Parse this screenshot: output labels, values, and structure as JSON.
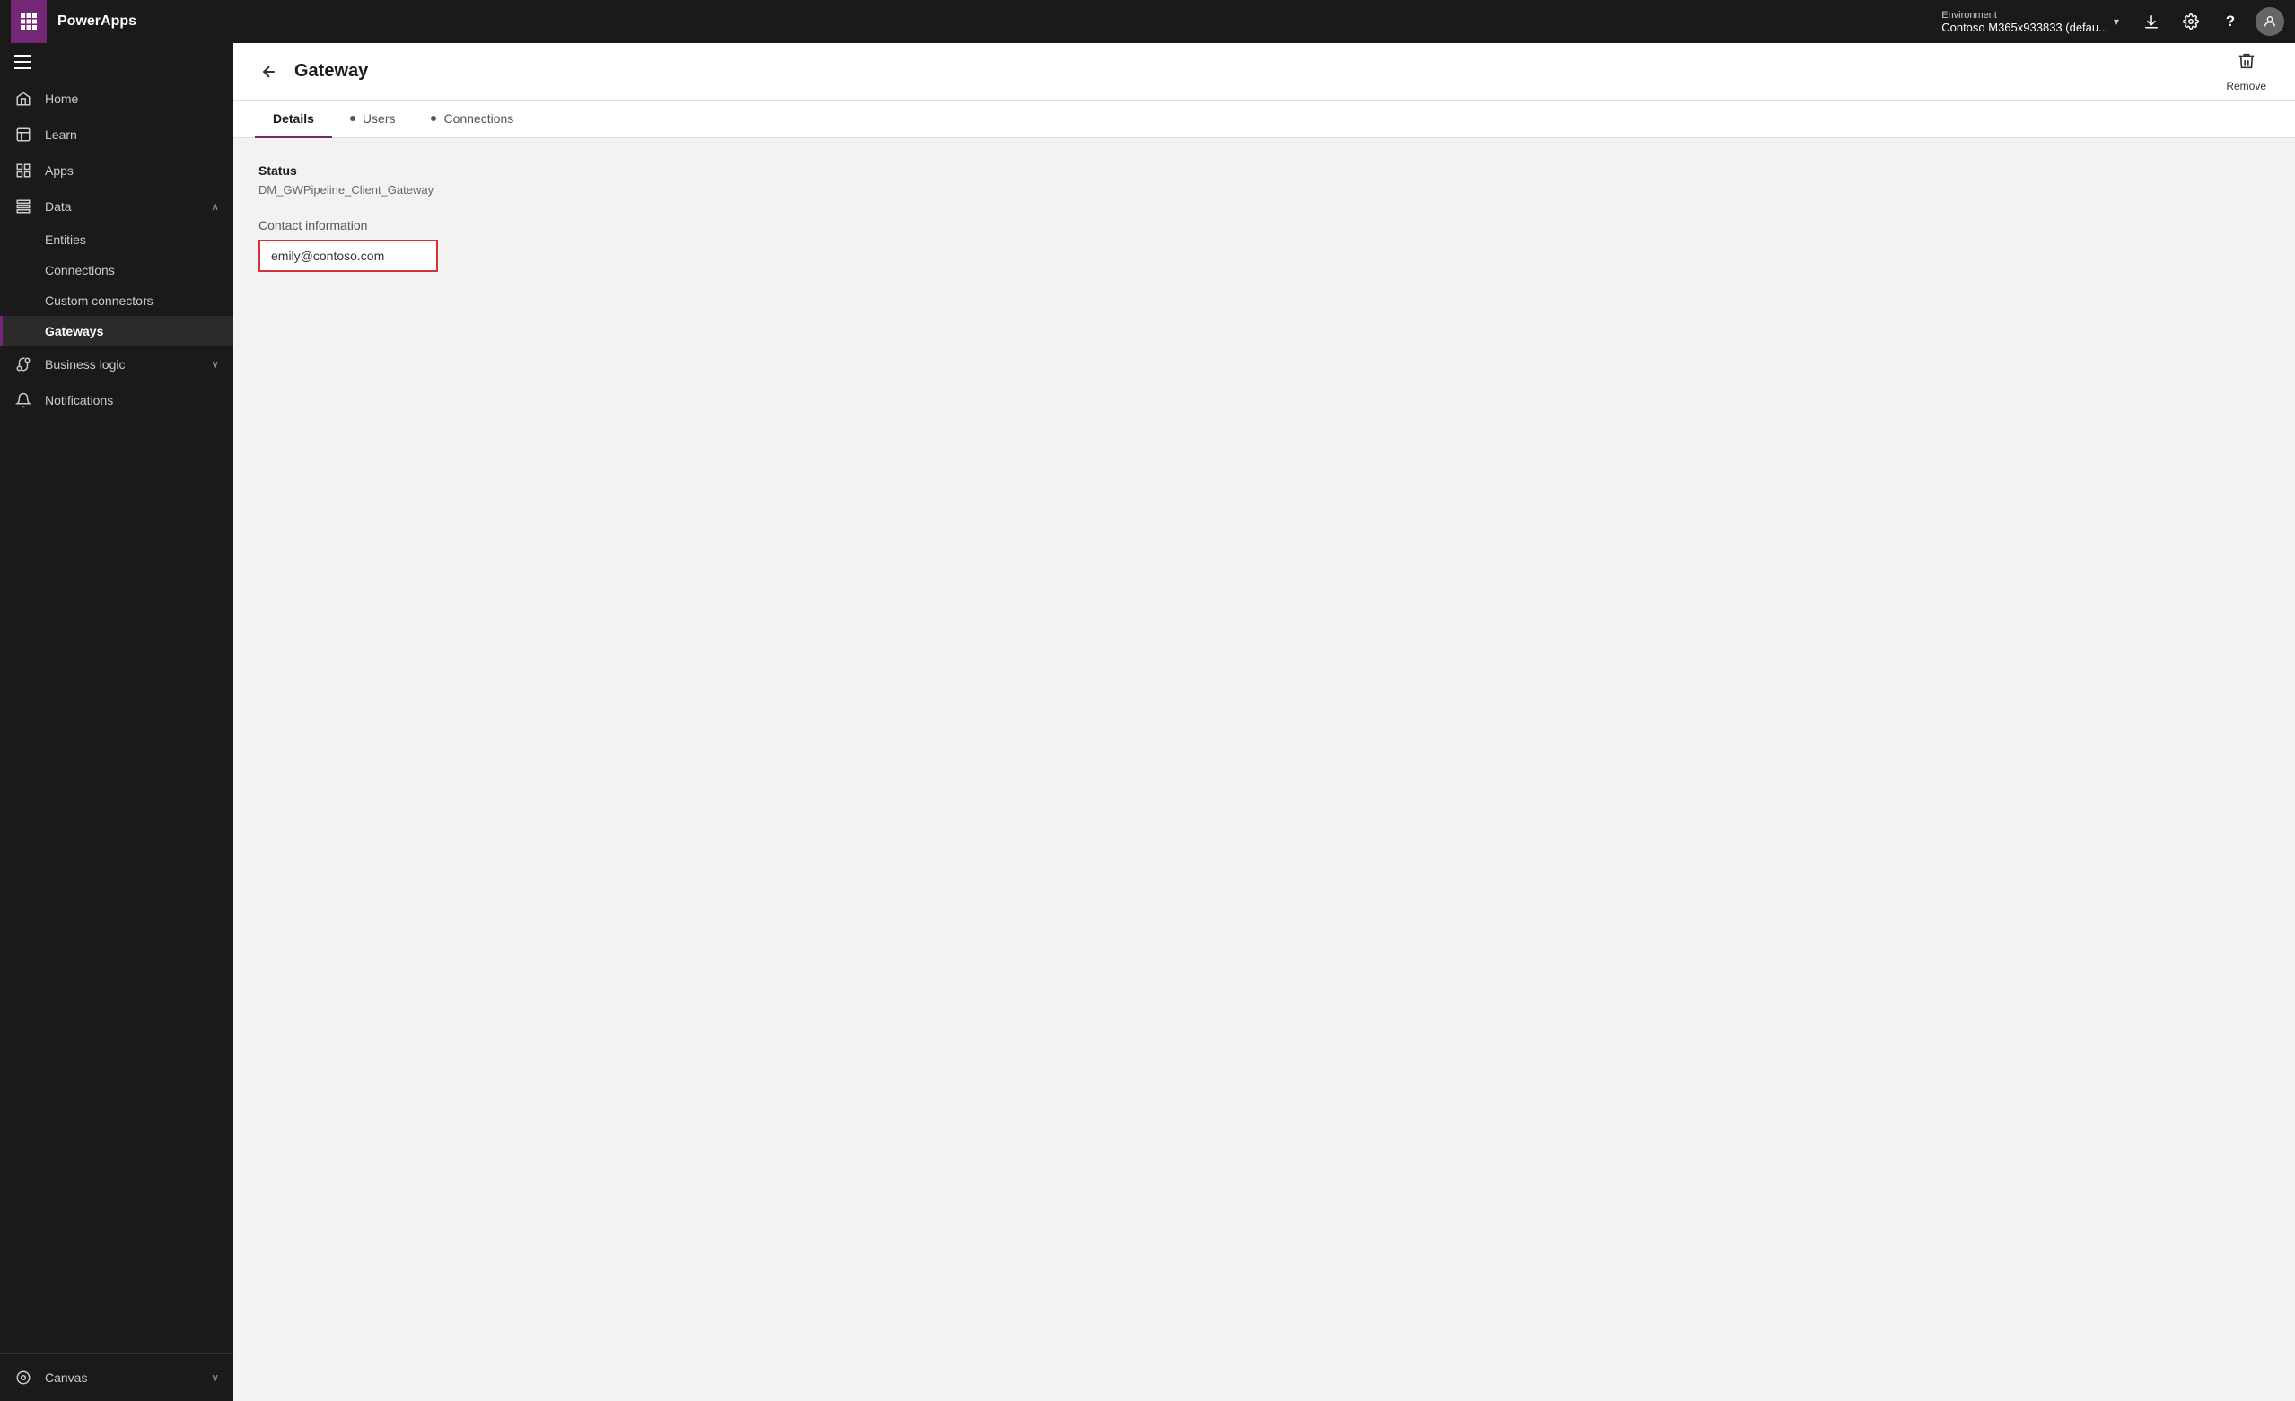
{
  "topbar": {
    "app_name": "PowerApps",
    "waffle_icon": "waffle",
    "environment_label": "Environment",
    "environment_value": "Contoso M365x933833 (defau...",
    "download_icon": "download",
    "settings_icon": "gear",
    "help_icon": "question",
    "user_icon": "person"
  },
  "sidebar": {
    "hamburger_icon": "menu",
    "items": [
      {
        "id": "home",
        "label": "Home",
        "icon": "home"
      },
      {
        "id": "learn",
        "label": "Learn",
        "icon": "book"
      },
      {
        "id": "apps",
        "label": "Apps",
        "icon": "grid"
      },
      {
        "id": "data",
        "label": "Data",
        "icon": "table",
        "expanded": true,
        "chevron": "up",
        "subitems": [
          {
            "id": "entities",
            "label": "Entities"
          },
          {
            "id": "connections",
            "label": "Connections"
          },
          {
            "id": "custom-connectors",
            "label": "Custom connectors"
          },
          {
            "id": "gateways",
            "label": "Gateways",
            "active": true
          }
        ]
      },
      {
        "id": "business-logic",
        "label": "Business logic",
        "icon": "process",
        "chevron": "down"
      },
      {
        "id": "notifications",
        "label": "Notifications",
        "icon": "bell"
      }
    ],
    "bottom": {
      "label": "Canvas",
      "icon": "canvas",
      "chevron": "down"
    }
  },
  "page": {
    "back_label": "←",
    "title": "Gateway",
    "remove_label": "Remove",
    "tabs": [
      {
        "id": "details",
        "label": "Details",
        "active": true
      },
      {
        "id": "users",
        "label": "Users"
      },
      {
        "id": "connections",
        "label": "Connections"
      }
    ],
    "status_label": "Status",
    "status_value": "DM_GWPipeline_Client_Gateway",
    "contact_label": "Contact information",
    "contact_email": "emily@contoso.com"
  }
}
